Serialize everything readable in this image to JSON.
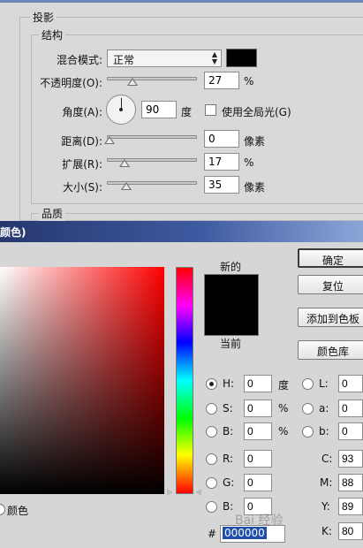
{
  "drop_shadow": {
    "title": "投影",
    "structure": {
      "title": "结构",
      "blend_mode": {
        "label": "混合模式:",
        "value": "正常",
        "swatch_color": "#000000"
      },
      "opacity": {
        "label": "不透明度(O):",
        "value": "27",
        "unit": "%"
      },
      "angle": {
        "label": "角度(A):",
        "value": "90",
        "unit": "度",
        "global_light_label": "使用全局光(G)",
        "global_light_checked": false
      },
      "distance": {
        "label": "距离(D):",
        "value": "0",
        "unit": "像素"
      },
      "spread": {
        "label": "扩展(R):",
        "value": "17",
        "unit": "%"
      },
      "size": {
        "label": "大小(S):",
        "value": "35",
        "unit": "像素"
      }
    },
    "quality": {
      "title": "品质"
    }
  },
  "color_picker": {
    "title": "颜色)",
    "new_label": "新的",
    "current_label": "当前",
    "new_color": "#000000",
    "buttons": {
      "ok": "确定",
      "reset": "复位",
      "add_swatches": "添加到色板",
      "libraries": "颜色库"
    },
    "only_web_colors_label": "颜色",
    "hsb": {
      "h": {
        "label": "H:",
        "value": "0",
        "unit": "度",
        "selected": true
      },
      "s": {
        "label": "S:",
        "value": "0",
        "unit": "%"
      },
      "b": {
        "label": "B:",
        "value": "0",
        "unit": "%"
      }
    },
    "lab": {
      "l": {
        "label": "L:",
        "value": "0"
      },
      "a": {
        "label": "a:",
        "value": "0"
      },
      "b": {
        "label": "b:",
        "value": "0"
      }
    },
    "rgb": {
      "r": {
        "label": "R:",
        "value": "0"
      },
      "g": {
        "label": "G:",
        "value": "0"
      },
      "b": {
        "label": "B:",
        "value": "0"
      }
    },
    "cmyk": {
      "c": {
        "label": "C:",
        "value": "93"
      },
      "m": {
        "label": "M:",
        "value": "88"
      },
      "y": {
        "label": "Y:",
        "value": "89"
      },
      "k": {
        "label": "K:",
        "value": "80"
      }
    },
    "hex": {
      "label": "#",
      "value": "000000"
    },
    "watermark": "Bai 经验"
  }
}
